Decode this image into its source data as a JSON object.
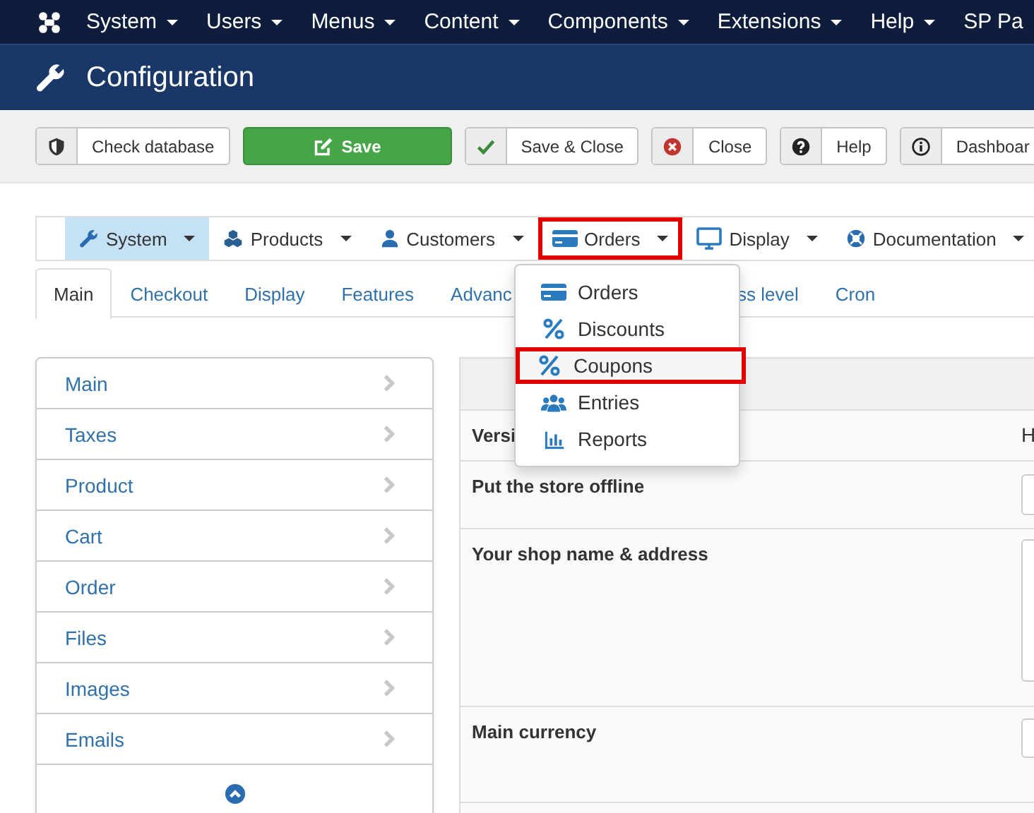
{
  "top_menu": [
    {
      "label": "System",
      "caret": true
    },
    {
      "label": "Users",
      "caret": true
    },
    {
      "label": "Menus",
      "caret": true
    },
    {
      "label": "Content",
      "caret": true
    },
    {
      "label": "Components",
      "caret": true
    },
    {
      "label": "Extensions",
      "caret": true
    },
    {
      "label": "Help",
      "caret": true
    },
    {
      "label": "SP Pa",
      "caret": false
    }
  ],
  "page_title": "Configuration",
  "toolbar": [
    {
      "label": "Check database",
      "kind": "default"
    },
    {
      "label": "Save",
      "kind": "primary"
    },
    {
      "label": "Save & Close",
      "kind": "default"
    },
    {
      "label": "Close",
      "kind": "default"
    },
    {
      "label": "Help",
      "kind": "default"
    },
    {
      "label": "Dashboar",
      "kind": "default"
    }
  ],
  "nav": [
    {
      "label": "System",
      "active": true,
      "highlighted": false
    },
    {
      "label": "Products",
      "active": false,
      "highlighted": false
    },
    {
      "label": "Customers",
      "active": false,
      "highlighted": false
    },
    {
      "label": "Orders",
      "active": false,
      "highlighted": true
    },
    {
      "label": "Display",
      "active": false,
      "highlighted": false
    },
    {
      "label": "Documentation",
      "active": false,
      "highlighted": false
    }
  ],
  "tabs": [
    {
      "label": "Main",
      "selected": true
    },
    {
      "label": "Checkout",
      "selected": false
    },
    {
      "label": "Display",
      "selected": false
    },
    {
      "label": "Features",
      "selected": false
    },
    {
      "label": "Advanc",
      "selected": false
    },
    {
      "label": "ss level",
      "selected": false
    },
    {
      "label": "Cron",
      "selected": false
    }
  ],
  "dropdown": [
    {
      "label": "Orders",
      "highlighted": false
    },
    {
      "label": "Discounts",
      "highlighted": false
    },
    {
      "label": "Coupons",
      "highlighted": true
    },
    {
      "label": "Entries",
      "highlighted": false
    },
    {
      "label": "Reports",
      "highlighted": false
    }
  ],
  "sidebar": {
    "items": [
      {
        "label": "Main"
      },
      {
        "label": "Taxes"
      },
      {
        "label": "Product"
      },
      {
        "label": "Cart"
      },
      {
        "label": "Order"
      },
      {
        "label": "Files"
      },
      {
        "label": "Images"
      },
      {
        "label": "Emails"
      }
    ]
  },
  "panel": {
    "column_1": "Versi",
    "column_2": "H",
    "rows": [
      {
        "label": "Put the store offline",
        "kind": "input"
      },
      {
        "label": "Your shop name & address",
        "kind": "textarea"
      },
      {
        "label": "Main currency",
        "kind": "select"
      }
    ]
  }
}
